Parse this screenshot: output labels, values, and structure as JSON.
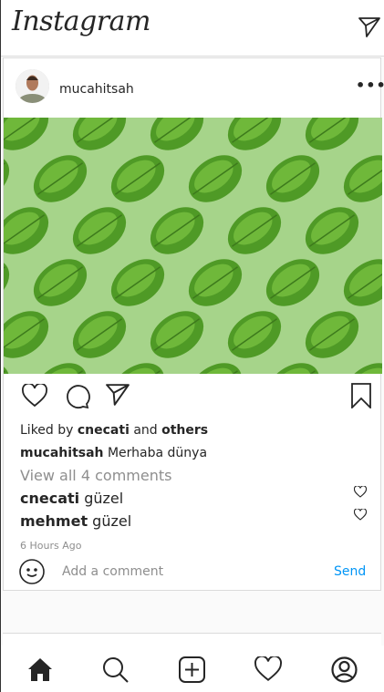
{
  "header": {
    "logo": "Instagram"
  },
  "post": {
    "username": "mucahitsah",
    "liked_prefix": "Liked by ",
    "liked_user": "cnecati",
    "liked_mid": " and ",
    "liked_others": "others",
    "caption_user": "mucahitsah",
    "caption": " Merhaba dünya",
    "view_all": "View all 4 comments",
    "comments": [
      {
        "user": "cnecati",
        "text": " güzel"
      },
      {
        "user": "mehmet",
        "text": " güzel"
      }
    ],
    "time": "6 Hours Ago",
    "add_comment_placeholder": "Add a comment",
    "send": "Send"
  },
  "colors": {
    "accent": "#0095f6",
    "image_bg": "#a6d48a",
    "leaf": "#4f9a26"
  }
}
